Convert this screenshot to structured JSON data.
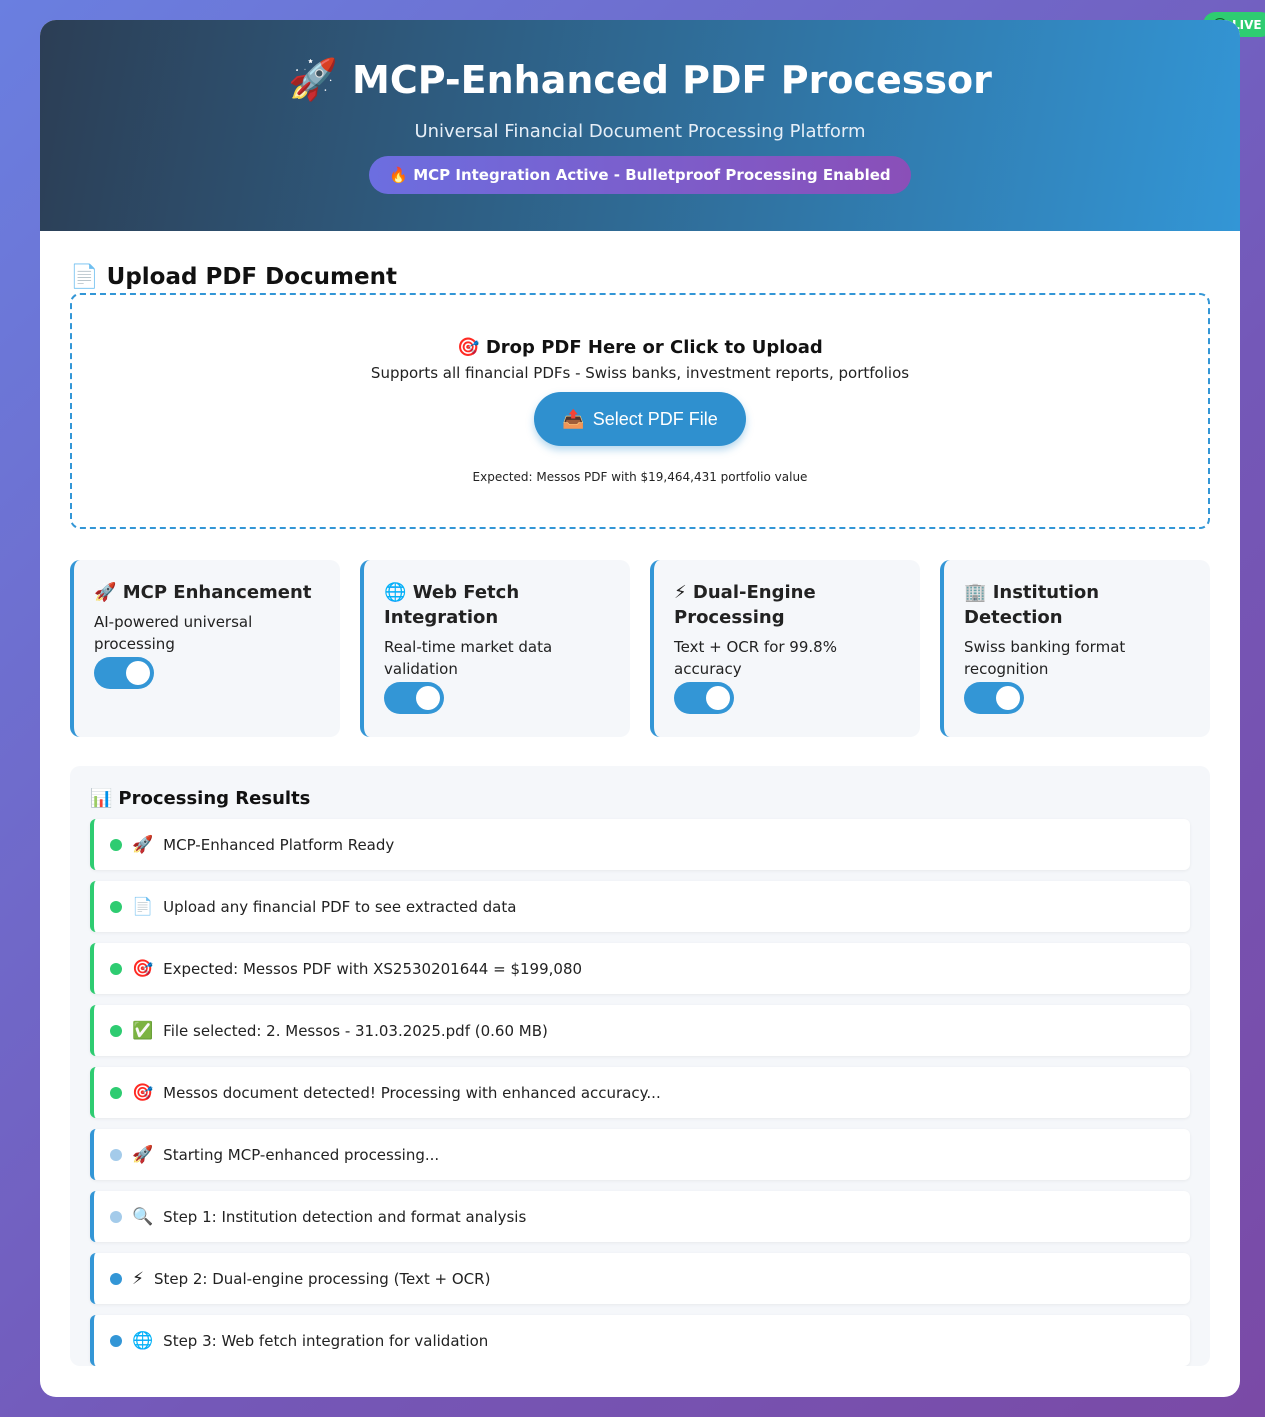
{
  "live_badge": "LIVE",
  "header": {
    "icon": "🚀",
    "title": "MCP-Enhanced PDF Processor",
    "subtitle": "Universal Financial Document Processing Platform",
    "status_pill": "🔥 MCP Integration Active - Bulletproof Processing Enabled"
  },
  "upload": {
    "section_icon": "📄",
    "section_title": "Upload PDF Document",
    "drop_title": "🎯 Drop PDF Here or Click to Upload",
    "drop_subtitle": "Supports all financial PDFs - Swiss banks, investment reports, portfolios",
    "button_icon": "📤",
    "button_label": "Select PDF File",
    "expected_note": "Expected: Messos PDF with $19,464,431 portfolio value"
  },
  "features": [
    {
      "icon": "🚀",
      "title": "MCP Enhancement",
      "description": "AI-powered universal processing",
      "enabled": true
    },
    {
      "icon": "🌐",
      "title": "Web Fetch Integration",
      "description": "Real-time market data validation",
      "enabled": true
    },
    {
      "icon": "⚡",
      "title": "Dual-Engine Processing",
      "description": "Text + OCR for 99.8% accuracy",
      "enabled": true
    },
    {
      "icon": "🏢",
      "title": "Institution Detection",
      "description": "Swiss banking format recognition",
      "enabled": true
    }
  ],
  "results": {
    "icon": "📊",
    "title": "Processing Results",
    "items": [
      {
        "icon": "🚀",
        "text": "MCP-Enhanced Platform Ready",
        "status": "success"
      },
      {
        "icon": "📄",
        "text": "Upload any financial PDF to see extracted data",
        "status": "success"
      },
      {
        "icon": "🎯",
        "text": "Expected: Messos PDF with XS2530201644 = $199,080",
        "status": "success"
      },
      {
        "icon": "✅",
        "text": "File selected: 2. Messos - 31.03.2025.pdf (0.60 MB)",
        "status": "success"
      },
      {
        "icon": "🎯",
        "text": "Messos document detected! Processing with enhanced accuracy...",
        "status": "success"
      },
      {
        "icon": "🚀",
        "text": "Starting MCP-enhanced processing...",
        "status": "pending"
      },
      {
        "icon": "🔍",
        "text": "Step 1: Institution detection and format analysis",
        "status": "pending"
      },
      {
        "icon": "⚡",
        "text": "Step 2: Dual-engine processing (Text + OCR)",
        "status": "active"
      },
      {
        "icon": "🌐",
        "text": "Step 3: Web fetch integration for validation",
        "status": "active"
      }
    ]
  }
}
